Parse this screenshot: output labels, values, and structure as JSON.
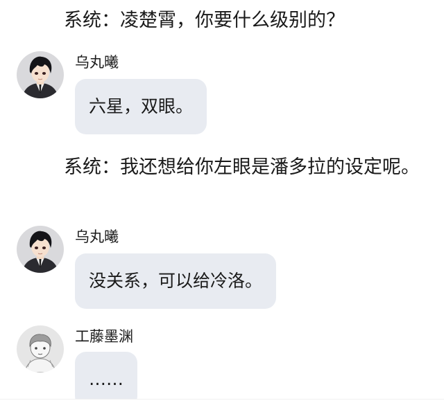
{
  "conversation": {
    "narration_1": "系统：凌楚霄，你要什么级别的？",
    "narration_2": "系统：我还想给你左眼是潘多拉的设定呢。",
    "messages": [
      {
        "sender": "乌丸曦",
        "text": "六星，双眼。",
        "avatar": "anime-boy-avatar-icon"
      },
      {
        "sender": "乌丸曦",
        "text": "没关系，可以给冷洛。",
        "avatar": "anime-boy-avatar-icon"
      },
      {
        "sender": "工藤墨渊",
        "text": "……",
        "avatar": "sketch-boy-avatar-icon"
      }
    ]
  },
  "colors": {
    "bubble_background": "#e8ebf1",
    "text": "#1a1a1a",
    "page_background": "#ffffff"
  }
}
